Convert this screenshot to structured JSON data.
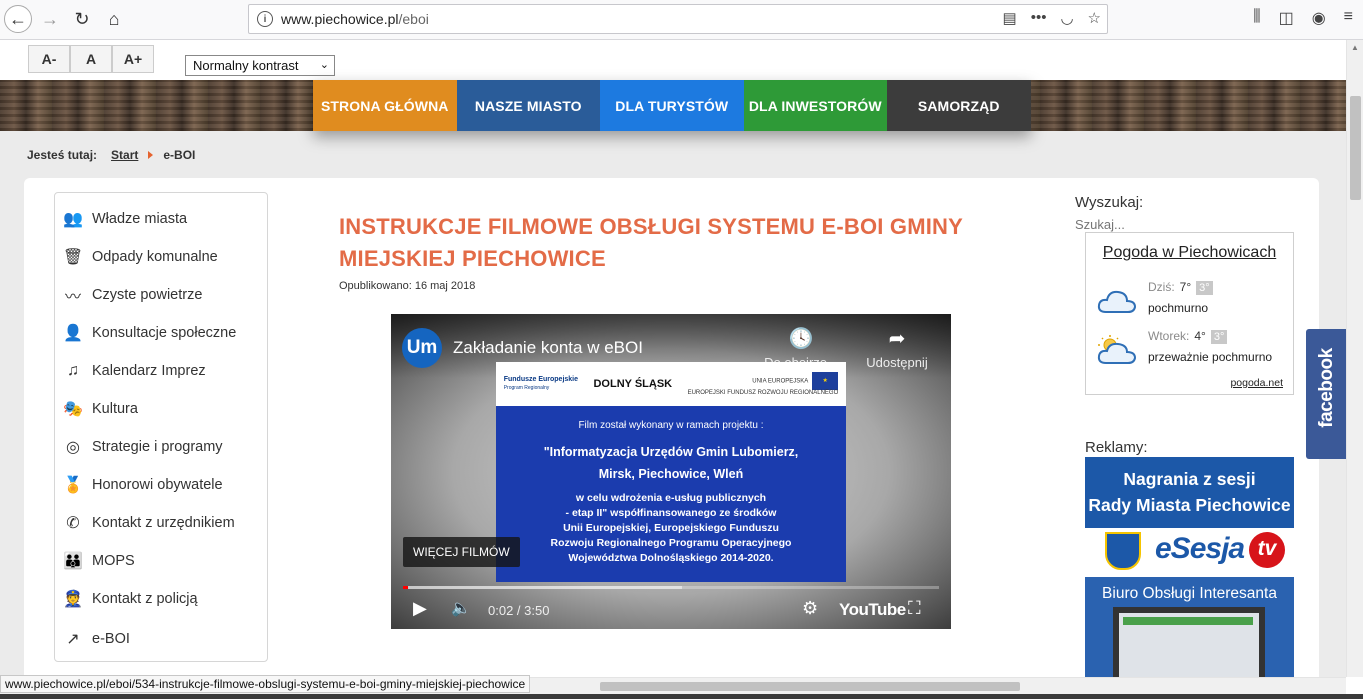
{
  "browser": {
    "url_host": "www.piechowice.pl",
    "url_path": "/eboi",
    "back_icon": "←",
    "forward_icon": "→",
    "reload_icon": "↻",
    "home_icon": "⌂",
    "info_icon": "i",
    "reader_icon": "▤",
    "more_icon": "•••",
    "pocket_icon": "◡",
    "star_icon": "☆",
    "library_icon": "⫼",
    "sidebar_icon": "◫",
    "account_icon": "◉",
    "menu_icon": "≡"
  },
  "accessibility": {
    "font_smaller": "A-",
    "font_normal": "A",
    "font_larger": "A+",
    "contrast_selected": "Normalny kontrast",
    "contrast_caret": "⌄"
  },
  "main_nav": [
    {
      "label": "STRONA GŁÓWNA",
      "color": "#e08c1f"
    },
    {
      "label": "NASZE MIASTO",
      "color": "#2a5c99"
    },
    {
      "label": "DLA TURYSTÓW",
      "color": "#1d7ae0"
    },
    {
      "label": "DLA INWESTORÓW",
      "color": "#2e9a37"
    },
    {
      "label": "SAMORZĄD",
      "color": "#3c3c3c"
    }
  ],
  "breadcrumb": {
    "label": "Jesteś tutaj:",
    "start": "Start",
    "current": "e-BOI"
  },
  "side_menu": [
    {
      "label": "Władze miasta",
      "icon": "people-icon",
      "glyph": "👥"
    },
    {
      "label": "Odpady komunalne",
      "icon": "trash-icon",
      "glyph": "🗑"
    },
    {
      "label": "Czyste powietrze",
      "icon": "wind-icon",
      "glyph": "〰"
    },
    {
      "label": "Konsultacje społeczne",
      "icon": "consultation-icon",
      "glyph": "👤"
    },
    {
      "label": "Kalendarz Imprez",
      "icon": "music-note-icon",
      "glyph": "♫"
    },
    {
      "label": "Kultura",
      "icon": "theater-masks-icon",
      "glyph": "🎭"
    },
    {
      "label": "Strategie i programy",
      "icon": "target-icon",
      "glyph": "◎"
    },
    {
      "label": "Honorowi obywatele",
      "icon": "medal-icon",
      "glyph": "🏅"
    },
    {
      "label": "Kontakt z urzędnikiem",
      "icon": "phone-icon",
      "glyph": "✆"
    },
    {
      "label": "MOPS",
      "icon": "social-care-icon",
      "glyph": "👪"
    },
    {
      "label": "Kontakt z policją",
      "icon": "police-icon",
      "glyph": "👮"
    },
    {
      "label": "e-BOI",
      "icon": "external-link-icon",
      "glyph": "↗"
    }
  ],
  "article": {
    "title": "INSTRUKCJE FILMOWE OBSŁUGI SYSTEMU E-BOI GMINY MIEJSKIEJ PIECHOWICE",
    "published": "Opublikowano: 16 maj 2018"
  },
  "video": {
    "channel_initials": "Um",
    "title": "Zakładanie konta w eBOI",
    "watch_later": "Do obejrze...",
    "watch_later_icon": "🕓",
    "share": "Udostępnij",
    "share_icon": "➦",
    "more_films": "WIĘCEJ FILMÓW",
    "time": "0:02 / 3:50",
    "progress_played": 0.01,
    "progress_loaded": 0.52,
    "yt_logo": "YouTube",
    "play_icon": "▶",
    "volume_icon": "🔈",
    "settings_icon": "⚙",
    "fullscreen_icon": "⛶",
    "slide": {
      "logo_fe": "Fundusze Europejskie",
      "logo_fe_sub": "Program Regionalny",
      "logo_ds": "DOLNY ŚLĄSK",
      "logo_ue": "UNIA EUROPEJSKA",
      "logo_ue_sub": "EUROPEJSKI FUNDUSZ ROZWOJU REGIONALNEGO",
      "line1": "Film został wykonany w ramach projektu :",
      "line2": "\"Informatyzacja Urzędów Gmin Lubomierz,",
      "line3": "Mirsk, Piechowice, Wleń",
      "line4": "w celu wdrożenia e-usług publicznych",
      "line5": "- etap II\" współfinansowanego  ze środków",
      "line6": "Unii Europejskiej,  Europejskiego Funduszu",
      "line7": "Rozwoju Regionalnego Programu Operacyjnego",
      "line8": "Województwa Dolnośląskiego 2014-2020."
    }
  },
  "sidebar_right": {
    "search_label": "Wyszukaj:",
    "search_placeholder": "Szukaj...",
    "weather": {
      "title": "Pogoda w Piechowicach",
      "today_label": "Dziś:",
      "today_temp": "7°",
      "today_badge": "3°",
      "today_desc": "pochmurno",
      "tomorrow_label": "Wtorek:",
      "tomorrow_temp": "4°",
      "tomorrow_badge": "3°",
      "tomorrow_desc": "przeważnie pochmurno",
      "source": "pogoda.net"
    },
    "ads_label": "Reklamy:",
    "ad1_line1": "Nagrania z sesji",
    "ad1_line2": "Rady Miasta Piechowice",
    "ad1_brand": "eSesja",
    "ad1_tv": "tv",
    "ad2_title": "Biuro Obsługi Interesanta"
  },
  "facebook_tab": "facebook",
  "status_bar": "www.piechowice.pl/eboi/534-instrukcje-filmowe-obslugi-systemu-e-boi-gminy-miejskiej-piechowice"
}
